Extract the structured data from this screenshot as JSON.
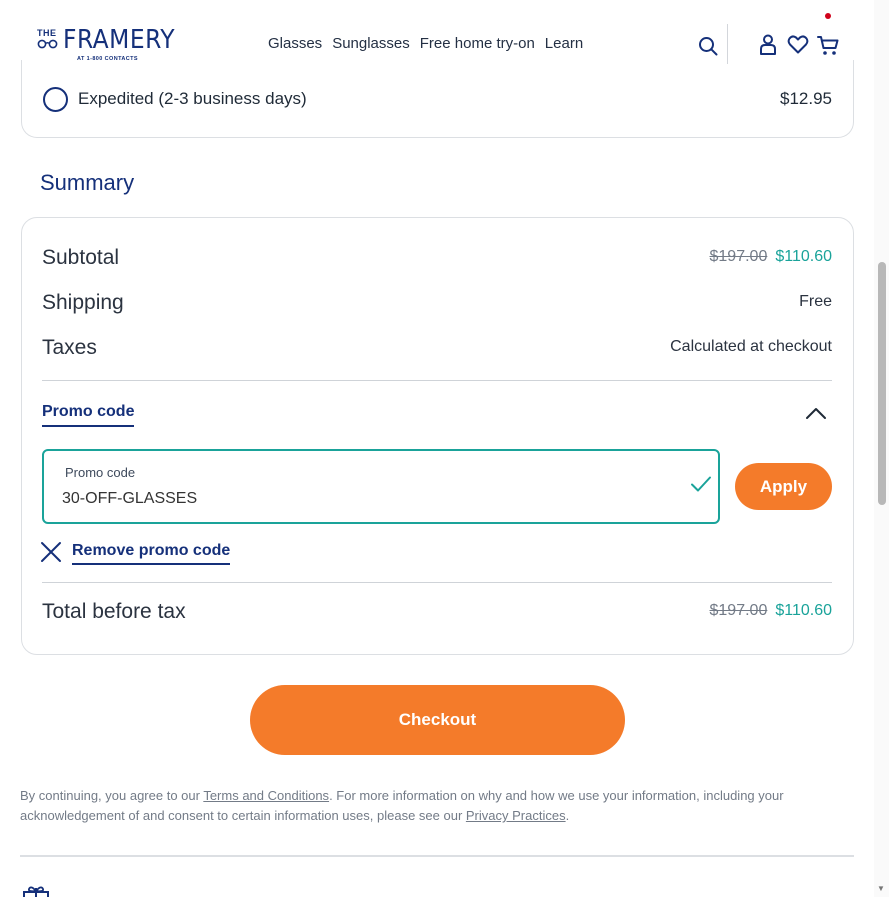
{
  "brand": {
    "top": "THE",
    "name": "FRAMERY",
    "tagline": "AT 1-800 CONTACTS",
    "color": "#15307a"
  },
  "nav": [
    "Glasses",
    "Sunglasses",
    "Free home try-on",
    "Learn"
  ],
  "header_icons": [
    "search-icon",
    "account-icon",
    "heart-icon",
    "cart-icon"
  ],
  "shipping": {
    "option_label": "Expedited (2-3 business days)",
    "option_price": "$12.95",
    "selected": false
  },
  "summary": {
    "title": "Summary",
    "subtotal_label": "Subtotal",
    "subtotal_original": "$197.00",
    "subtotal_sale": "$110.60",
    "shipping_label": "Shipping",
    "shipping_value": "Free",
    "taxes_label": "Taxes",
    "taxes_value": "Calculated at checkout",
    "promo_toggle": "Promo code",
    "promo_field_label": "Promo code",
    "promo_value": "30-OFF-GLASSES",
    "apply_label": "Apply",
    "remove_label": "Remove promo code",
    "total_label": "Total before tax",
    "total_original": "$197.00",
    "total_sale": "$110.60"
  },
  "checkout_label": "Checkout",
  "legal": {
    "prefix": "By continuing, you agree to our ",
    "terms_link": "Terms and Conditions",
    "middle": ". For more information on why and how we use your information, including your acknowledgement of and consent to certain information uses, please see our ",
    "privacy_link": "Privacy Practices",
    "suffix": "."
  },
  "colors": {
    "accent_orange": "#f47b2a",
    "sale_teal": "#1aa39a",
    "navy": "#15307a",
    "cart_badge": "#d0021b"
  }
}
